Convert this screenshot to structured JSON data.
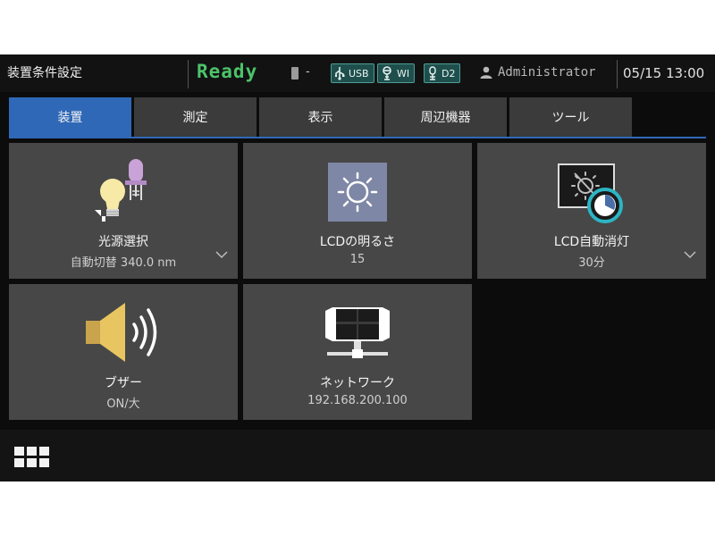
{
  "header": {
    "page_title": "装置条件設定",
    "status": "Ready",
    "status_color": "#4cc36a",
    "battery_value": "-",
    "badges": [
      {
        "icon": "usb-icon",
        "label": "USB"
      },
      {
        "icon": "wifi-icon",
        "label": "WI"
      },
      {
        "icon": "d2-lamp-icon",
        "label": "D2"
      }
    ],
    "user": "Administrator",
    "datetime": "05/15  13:00"
  },
  "tabs": [
    {
      "label": "装置",
      "active": true
    },
    {
      "label": "測定",
      "active": false
    },
    {
      "label": "表示",
      "active": false
    },
    {
      "label": "周辺機器",
      "active": false
    },
    {
      "label": "ツール",
      "active": false
    }
  ],
  "tiles": [
    {
      "icon": "light-source-icon",
      "title": "光源選択",
      "value": "自動切替 340.0 nm",
      "has_dropdown": true
    },
    {
      "icon": "brightness-icon",
      "title": "LCDの明るさ",
      "value": "15",
      "has_dropdown": false
    },
    {
      "icon": "lcd-auto-off-icon",
      "title": "LCD自動消灯",
      "value": "30分",
      "has_dropdown": true
    },
    {
      "icon": "speaker-icon",
      "title": "ブザー",
      "value": "ON/大",
      "has_dropdown": false
    },
    {
      "icon": "network-icon",
      "title": "ネットワーク",
      "value": "192.168.200.100",
      "has_dropdown": false
    }
  ],
  "colors": {
    "accent": "#2f68b6",
    "tile_bg": "#474747",
    "badge_bg": "#1f4f4c"
  },
  "bottom_bar": {
    "icon": "app-grid-icon"
  }
}
